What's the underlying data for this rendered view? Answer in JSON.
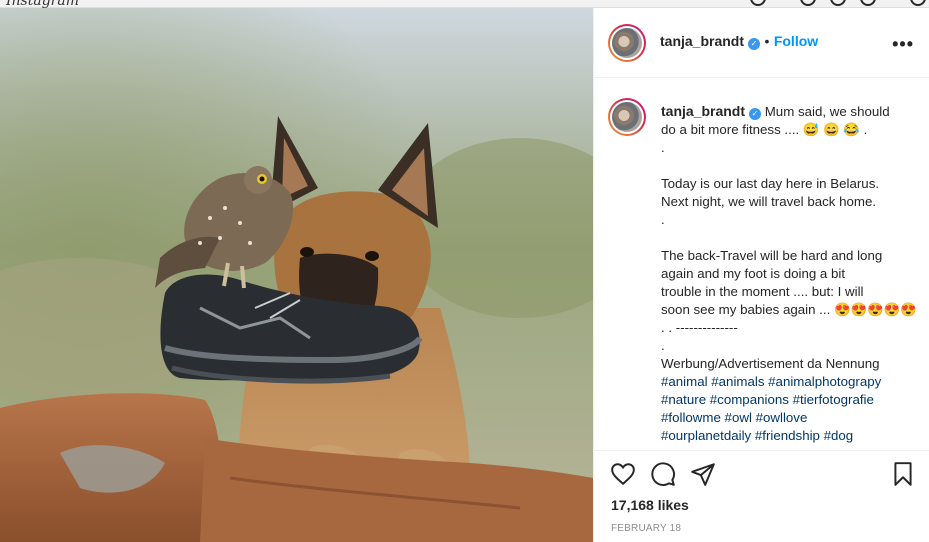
{
  "browser": {
    "partial_title": "Instagram"
  },
  "post": {
    "username": "tanja_brandt",
    "verified_mark": "✓",
    "separator": "•",
    "follow_label": "Follow",
    "more_label": "•••",
    "caption_lines": [
      "Mum said, we should",
      "do a bit more fitness .... 😅 😄 😂 .",
      ".",
      "",
      "Today is our last day here in Belarus.",
      "Next night, we will travel back home.",
      ".",
      "",
      "The back-Travel will be hard and long",
      "again and my foot is doing a bit",
      "trouble in the moment .... but: I will",
      "soon see my babies again ... 😍😍😍😍😍",
      ". . --------------",
      ".",
      "Werbung/Advertisement da Nennung"
    ],
    "hashtag_lines": [
      "#animal #animals #animalphotograpy",
      "#nature #companions #tierfotografie",
      "#followme #owl #owllove",
      "#ourplanetdaily #friendship #dog"
    ],
    "likes": "17,168 likes",
    "date": "FEBRUARY 18"
  },
  "icons": {
    "like": "heart-icon",
    "comment": "comment-icon",
    "share": "share-icon",
    "save": "bookmark-icon",
    "more": "more-options-icon",
    "verified": "verified-badge-icon"
  },
  "colors": {
    "follow": "#0095f6",
    "verified": "#3897f0",
    "hashtag": "#00376b",
    "text": "#262626",
    "muted": "#8e8e8e"
  }
}
